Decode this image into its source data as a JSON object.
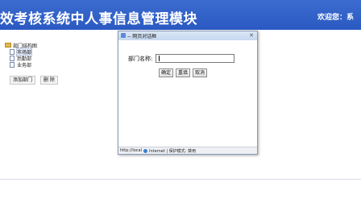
{
  "header": {
    "title": "效考核系统中人事信息管理模块",
    "welcome": "欢迎您：系"
  },
  "tree": {
    "root_label": "部门结构图",
    "items": [
      {
        "label": "市场部",
        "selected": true
      },
      {
        "label": "后勤部",
        "selected": false
      },
      {
        "label": "业务部",
        "selected": false
      }
    ]
  },
  "sidebar_buttons": {
    "add_label": "添加部门",
    "delete_label": "删 除"
  },
  "dialog": {
    "title": "-- 网页对话框",
    "close_glyph": "✕",
    "field_label": "部门名称:",
    "field_value": "",
    "confirm_label": "确定",
    "reset_label": "重填",
    "cancel_label": "取消",
    "status": {
      "url": "http://local",
      "zone": "Internet | 保护模式: 禁用"
    }
  },
  "colors": {
    "header_bg": "#2f5fc8",
    "selected_bg": "#dfe7f7"
  }
}
